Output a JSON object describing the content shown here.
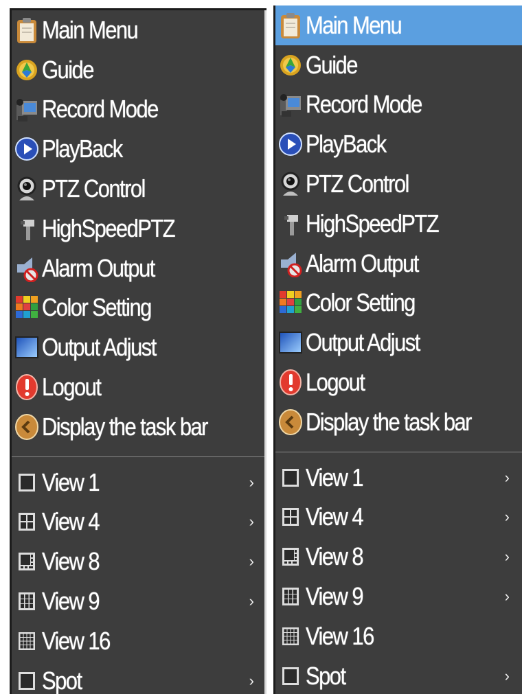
{
  "menus": [
    {
      "id": "left",
      "selected_index": -1,
      "items": [
        {
          "label": "Main Menu",
          "icon": "clipboard-icon"
        },
        {
          "label": "Guide",
          "icon": "compass-icon"
        },
        {
          "label": "Record Mode",
          "icon": "camcorder-icon"
        },
        {
          "label": "PlayBack",
          "icon": "play-icon"
        },
        {
          "label": "PTZ Control",
          "icon": "ptz-camera-icon"
        },
        {
          "label": "HighSpeedPTZ",
          "icon": "speed-dome-icon"
        },
        {
          "label": "Alarm Output",
          "icon": "alarm-speaker-icon"
        },
        {
          "label": "Color Setting",
          "icon": "color-grid-icon"
        },
        {
          "label": "Output Adjust",
          "icon": "display-icon"
        },
        {
          "label": "Logout",
          "icon": "exclamation-icon"
        },
        {
          "label": "Display the task bar",
          "icon": "back-arrow-icon"
        }
      ],
      "views": [
        {
          "label": "View 1",
          "icon": "view-1-icon",
          "submenu": true
        },
        {
          "label": "View 4",
          "icon": "view-4-icon",
          "submenu": true
        },
        {
          "label": "View 8",
          "icon": "view-8-icon",
          "submenu": true
        },
        {
          "label": "View 9",
          "icon": "view-9-icon",
          "submenu": true
        },
        {
          "label": "View 16",
          "icon": "view-16-icon",
          "submenu": false
        },
        {
          "label": "Spot",
          "icon": "spot-icon",
          "submenu": true
        }
      ]
    },
    {
      "id": "right",
      "selected_index": 0,
      "items": [
        {
          "label": "Main Menu",
          "icon": "clipboard-icon"
        },
        {
          "label": "Guide",
          "icon": "compass-icon"
        },
        {
          "label": "Record Mode",
          "icon": "camcorder-icon"
        },
        {
          "label": "PlayBack",
          "icon": "play-icon"
        },
        {
          "label": "PTZ Control",
          "icon": "ptz-camera-icon"
        },
        {
          "label": "HighSpeedPTZ",
          "icon": "speed-dome-icon"
        },
        {
          "label": "Alarm Output",
          "icon": "alarm-speaker-icon"
        },
        {
          "label": "Color Setting",
          "icon": "color-grid-icon"
        },
        {
          "label": "Output Adjust",
          "icon": "display-icon"
        },
        {
          "label": "Logout",
          "icon": "exclamation-icon"
        },
        {
          "label": "Display the task bar",
          "icon": "back-arrow-icon"
        }
      ],
      "views": [
        {
          "label": "View 1",
          "icon": "view-1-icon",
          "submenu": true
        },
        {
          "label": "View 4",
          "icon": "view-4-icon",
          "submenu": true
        },
        {
          "label": "View 8",
          "icon": "view-8-icon",
          "submenu": true
        },
        {
          "label": "View 9",
          "icon": "view-9-icon",
          "submenu": true
        },
        {
          "label": "View 16",
          "icon": "view-16-icon",
          "submenu": false
        },
        {
          "label": "Spot",
          "icon": "spot-icon",
          "submenu": true
        }
      ]
    }
  ],
  "submenu_arrow": "›",
  "colors": {
    "menu_bg": "#3d3d3d",
    "selected_bg": "#5b9fe0",
    "text": "#ffffff"
  }
}
